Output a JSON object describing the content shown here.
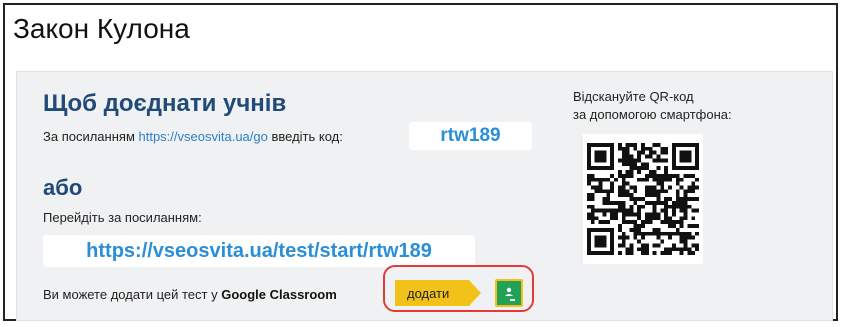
{
  "title": "Закон Кулона",
  "join": {
    "heading": "Щоб доєднати учнів",
    "link_prefix": "За посиланням ",
    "link_url": "https://vseosvita.ua/go",
    "link_suffix": " введіть код:",
    "code": "rtw189"
  },
  "alt": {
    "heading": "або",
    "goto_text": "Перейдіть за посиланням:",
    "full_url": "https://vseosvita.ua/test/start/rtw189"
  },
  "classroom": {
    "text_prefix": "Ви можете додати цей тест у ",
    "brand": "Google Classroom",
    "add_label": "додати",
    "icon_name": "google-classroom-icon"
  },
  "qr": {
    "caption_line1": "Відскануйте QR-код",
    "caption_line2": "за допомогою смартфона:",
    "icon_name": "qr-code-icon"
  },
  "colors": {
    "heading": "#214a78",
    "link": "#2a8fd6",
    "add_button": "#f2c21a",
    "classroom_green": "#22a257",
    "highlight": "#e53a3a"
  }
}
